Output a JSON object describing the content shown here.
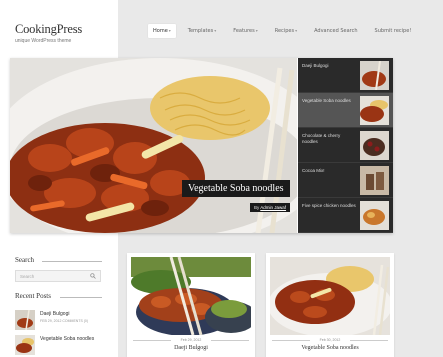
{
  "site": {
    "name": "CookingPress",
    "tagline": "unique WordPress theme"
  },
  "nav": {
    "items": [
      {
        "label": "Home",
        "active": true,
        "dropdown": true
      },
      {
        "label": "Templates",
        "active": false,
        "dropdown": true
      },
      {
        "label": "Features",
        "active": false,
        "dropdown": true
      },
      {
        "label": "Recipes",
        "active": false,
        "dropdown": true
      },
      {
        "label": "Advanced Search",
        "active": false,
        "dropdown": false
      },
      {
        "label": "Submit recipe!",
        "active": false,
        "dropdown": false
      }
    ]
  },
  "slider": {
    "title": "Vegetable Soba noodles",
    "author_prefix": "By",
    "author": "Admin Jawaf",
    "thumbs": [
      {
        "label": "Daeji Bulgogi",
        "active": false
      },
      {
        "label": "Vegetable Soba noodles",
        "active": true
      },
      {
        "label": "Chocolate & cherry noodles",
        "active": false
      },
      {
        "label": "Cocoa Mix!",
        "active": false
      },
      {
        "label": "Five spice chicken noodles",
        "active": false
      }
    ]
  },
  "sidebar": {
    "search_title": "Search",
    "search_placeholder": "Search",
    "recent_title": "Recent Posts",
    "recent": [
      {
        "title": "Daeji Bulgogi",
        "meta": "FEB 29, 2012 COMMENTS (0)"
      },
      {
        "title": "Vegetable Soba noodles",
        "meta": ""
      }
    ]
  },
  "cards": [
    {
      "date": "Feb 29, 2012",
      "title": "Daeji Bulgogi"
    },
    {
      "date": "Feb 30, 2012",
      "title": "Vegetable Soba noodles"
    }
  ],
  "colors": {
    "page_bg": "#e9e9e9",
    "dark": "#1a1a1a",
    "thumb_bg": "#2a2a2a"
  }
}
